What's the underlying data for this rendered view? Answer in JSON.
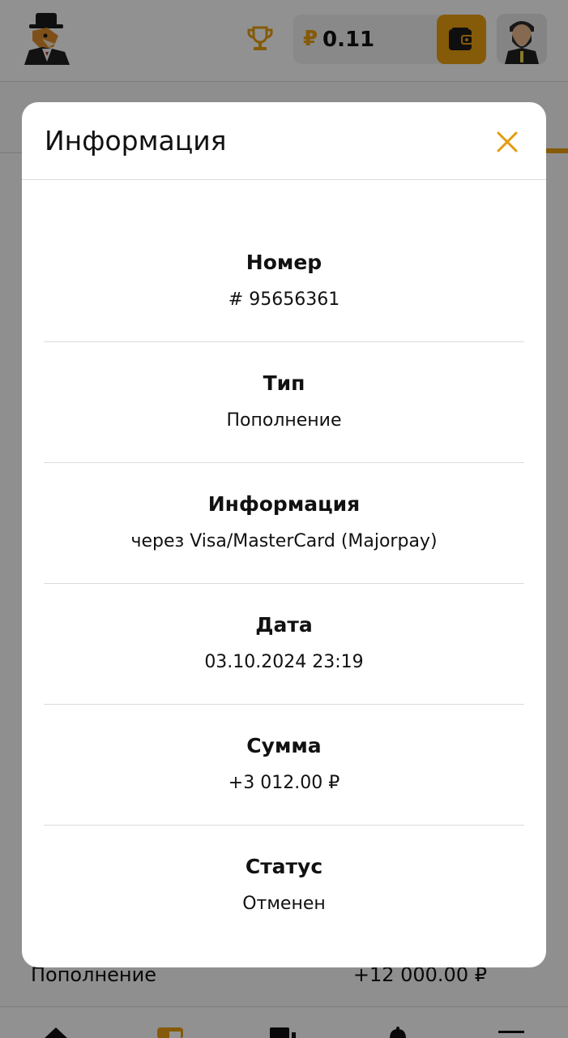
{
  "header": {
    "balance": {
      "currency": "₽",
      "amount": "0.11"
    }
  },
  "background_list": {
    "row": {
      "type": "Пополнение",
      "amount": "+12 000.00 ₽"
    }
  },
  "modal": {
    "title": "Информация",
    "rows": [
      {
        "label": "Номер",
        "value": "# 95656361"
      },
      {
        "label": "Тип",
        "value": "Пополнение"
      },
      {
        "label": "Информация",
        "value": "через Visa/MasterCard (Majorpay)"
      },
      {
        "label": "Дата",
        "value": "03.10.2024 23:19"
      },
      {
        "label": "Сумма",
        "value": "+3 012.00 ₽"
      },
      {
        "label": "Статус",
        "value": "Отменен"
      }
    ]
  },
  "colors": {
    "accent": "#e59b0f",
    "text": "#111111",
    "modal_bg": "#ffffff",
    "overlay": "rgba(0,0,0,0.42)"
  },
  "icons": {
    "logo": "fox-in-top-hat-logo",
    "trophy": "trophy-icon",
    "wallet": "wallet-icon",
    "avatar": "bearded-man-avatar",
    "close": "close-icon",
    "nav": [
      "home-icon",
      "wallet-nav-icon",
      "games-icon",
      "notifications-icon",
      "menu-icon"
    ]
  }
}
